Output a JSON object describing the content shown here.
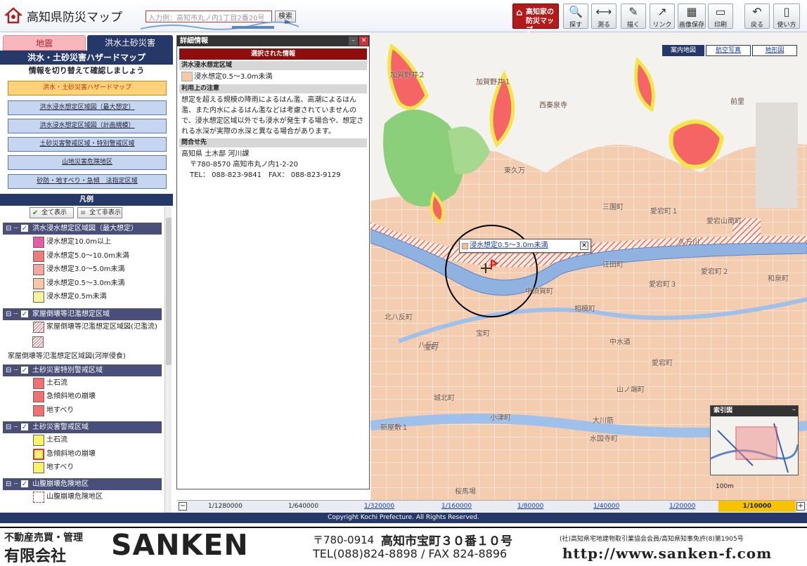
{
  "header": {
    "title": "高知県防災マップ",
    "search_placeholder": "入力例：高知市丸ノ内1丁目2番20号",
    "search_button": "検索",
    "home_label_1": "高知家の",
    "home_label_2": "防災マップ",
    "tools": [
      {
        "label": "探す",
        "glyph": "🔍"
      },
      {
        "label": "測る",
        "glyph": "⟷"
      },
      {
        "label": "描く",
        "glyph": "✎"
      },
      {
        "label": "リンク",
        "glyph": "↗"
      },
      {
        "label": "画像保存",
        "glyph": "▦"
      },
      {
        "label": "印刷",
        "glyph": "▭"
      },
      {
        "label": "戻る",
        "glyph": "↶"
      },
      {
        "label": "使い方",
        "glyph": "▯"
      }
    ]
  },
  "tabs": {
    "quake": "地震",
    "flood": "洪水土砂災害"
  },
  "left": {
    "heading": "洪水・土砂災害ハザードマップ",
    "subheading": "情報を切り替えて確認しましょう",
    "menu": [
      "洪水・土砂災害ハザードマップ",
      "洪水浸水想定区域図（最大想定）",
      "洪水浸水想定区域図（計画規模）",
      "土砂災害警戒区域・特別警戒区域",
      "山地災害危険地区",
      "砂防・地すべり・急傾　法指定区域"
    ],
    "legend_title": "凡例",
    "show_all": "全て表示",
    "hide_all": "全て非表示",
    "groups": [
      {
        "title": "洪水浸水想定区域図（最大想定）",
        "items": [
          "浸水想定10.0m以上",
          "浸水想定5.0～10.0m未満",
          "浸水想定3.0～5.0m未満",
          "浸水想定0.5～3.0m未満",
          "浸水想定0.5m未満"
        ]
      },
      {
        "title": "家屋倒壊等氾濫想定区域",
        "items": [
          "家屋倒壊等氾濫想定区域図(氾濫流)"
        ],
        "extra": "家屋倒壊等氾濫想定区域図(河岸侵食)"
      },
      {
        "title": "土砂災害特別警戒区域",
        "items": [
          "土石流",
          "急傾斜地の崩壊",
          "地すべり"
        ]
      },
      {
        "title": "土砂災害警戒区域",
        "items": [
          "土石流",
          "急傾斜地の崩壊",
          "地すべり"
        ]
      },
      {
        "title": "山腹崩壊危険地区",
        "items": [
          "山腹崩壊危険地区"
        ]
      }
    ],
    "colors": {
      "c1": "#e65aa6",
      "c2": "#f07b7b",
      "c3": "#f3a9a2",
      "c4": "#f7c8a4",
      "c5": "#fbf39a",
      "ss": "#f27070",
      "sk": "#fbf26b"
    }
  },
  "detail": {
    "window_title": "詳細情報",
    "selected": "選択された情報",
    "area_header": "洪水浸水想定区域",
    "area_value": "浸水想定0.5～3.0m未満",
    "note_header": "利用上の注意",
    "note_text": "想定を超える規模の降雨によるはん濫、高潮によるはん濫、また内水によるはん濫などは考慮されていませんので、浸水想定区域以外でも浸水が発生する場合や、想定される水深が実際の水深と異なる場合があります。",
    "contact_header": "問合せ先",
    "contact_lines": [
      "高知県 土木部 河川課",
      "〒780-8570 高知市丸ノ内1-2-20",
      "TEL： 088-823-9841　FAX： 088-823-9129"
    ]
  },
  "map": {
    "tabs": [
      "案内地図",
      "航空写真",
      "地形図"
    ],
    "popup": "浸水想定0.5～3.0m未満",
    "overview_title": "索引図",
    "scale_label": "100m",
    "labels": [
      "加賀野井２",
      "加賀野井１",
      "西秦泉寺",
      "前里",
      "東久万",
      "三園町",
      "愛宕町１",
      "愛宕山南町",
      "久万川",
      "江田町",
      "和泉町",
      "北八反町",
      "相模町",
      "宝町",
      "八反町",
      "中水道",
      "宝町",
      "愛宕町",
      "城北町",
      "小津町",
      "大川筋",
      "新屋敷１",
      "水国寺町",
      "桜馬場",
      "中須賀町",
      "愛宕町３",
      "愛宕町２",
      "山ノ端町"
    ]
  },
  "scales": [
    "1/1280000",
    "1/640000",
    "1/320000",
    "1/160000",
    "1/80000",
    "1/40000",
    "1/20000",
    "1/10000"
  ],
  "copyright": "Copyright Kochi Prefecture. All Rights Reserved.",
  "banner": {
    "line1": "不動産売買・管理",
    "line2": "有限会社",
    "brand": "SANKEN",
    "postal": "〒780-0914",
    "address": "高知市宝町３０番１０号",
    "tel": "TEL(088)824-8898 / FAX 824-8896",
    "member": "(社)高知県宅地建物取引業協会会員/高知県知事免許(8)第1905号",
    "url": "http://www.sanken-f.com"
  }
}
